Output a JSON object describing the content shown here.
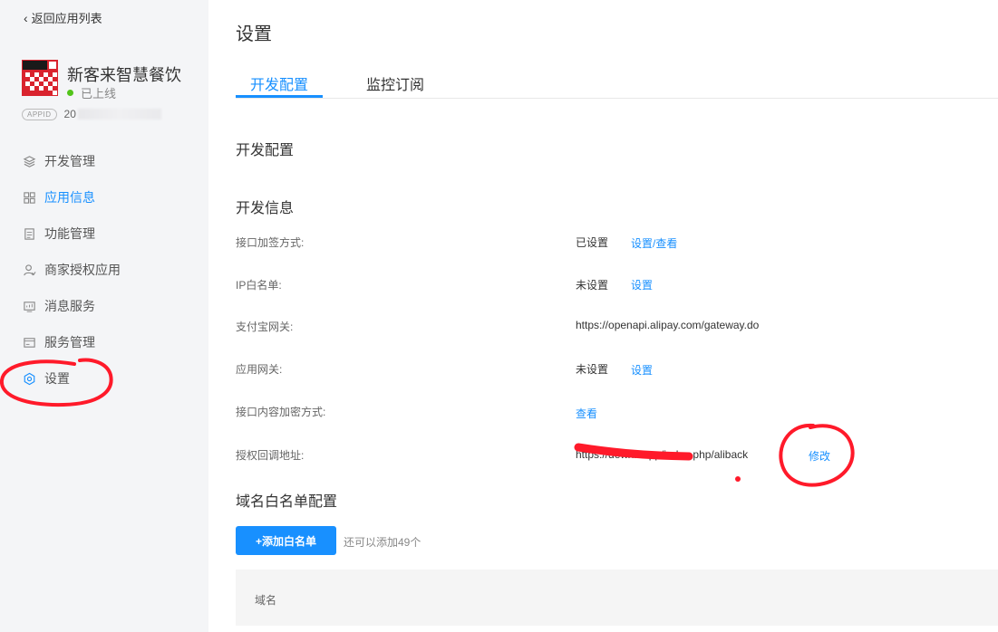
{
  "sidebar": {
    "back_label": "返回应用列表",
    "app_name": "新客来智慧餐饮",
    "app_status": "已上线",
    "appid_badge": "APPID",
    "appid_value": "20",
    "items": [
      {
        "label": "开发管理",
        "icon": "layers-icon"
      },
      {
        "label": "应用信息",
        "icon": "grid-icon"
      },
      {
        "label": "功能管理",
        "icon": "document-icon"
      },
      {
        "label": "商家授权应用",
        "icon": "user-icon"
      },
      {
        "label": "消息服务",
        "icon": "monitor-icon"
      },
      {
        "label": "服务管理",
        "icon": "card-icon"
      },
      {
        "label": "设置",
        "icon": "gear-icon"
      }
    ]
  },
  "main": {
    "title": "设置",
    "tabs": [
      {
        "label": "开发配置"
      },
      {
        "label": "监控订阅"
      }
    ],
    "section_dev_config": "开发配置",
    "section_dev_info": "开发信息",
    "rows": [
      {
        "label": "接口加签方式:",
        "value": "已设置",
        "link": "设置/查看"
      },
      {
        "label": "IP白名单:",
        "value": "未设置",
        "link": "设置"
      },
      {
        "label": "支付宝网关:",
        "value": "https://openapi.alipay.com/gateway.do",
        "link": ""
      },
      {
        "label": "应用网关:",
        "value": "未设置",
        "link": "设置"
      },
      {
        "label": "接口内容加密方式:",
        "value": "",
        "link": "查看"
      },
      {
        "label": "授权回调地址:",
        "value": "https://dewx.....pp/index.php/aliback",
        "link": "修改"
      }
    ],
    "section_domain_whitelist": "域名白名单配置",
    "add_button": "+添加白名单",
    "add_hint": "还可以添加49个",
    "table_header_domain": "域名"
  },
  "colors": {
    "accent": "#1890ff",
    "annotation": "#ff1a2a",
    "status_online": "#52c41a",
    "sidebar_bg": "#f4f5f7"
  }
}
